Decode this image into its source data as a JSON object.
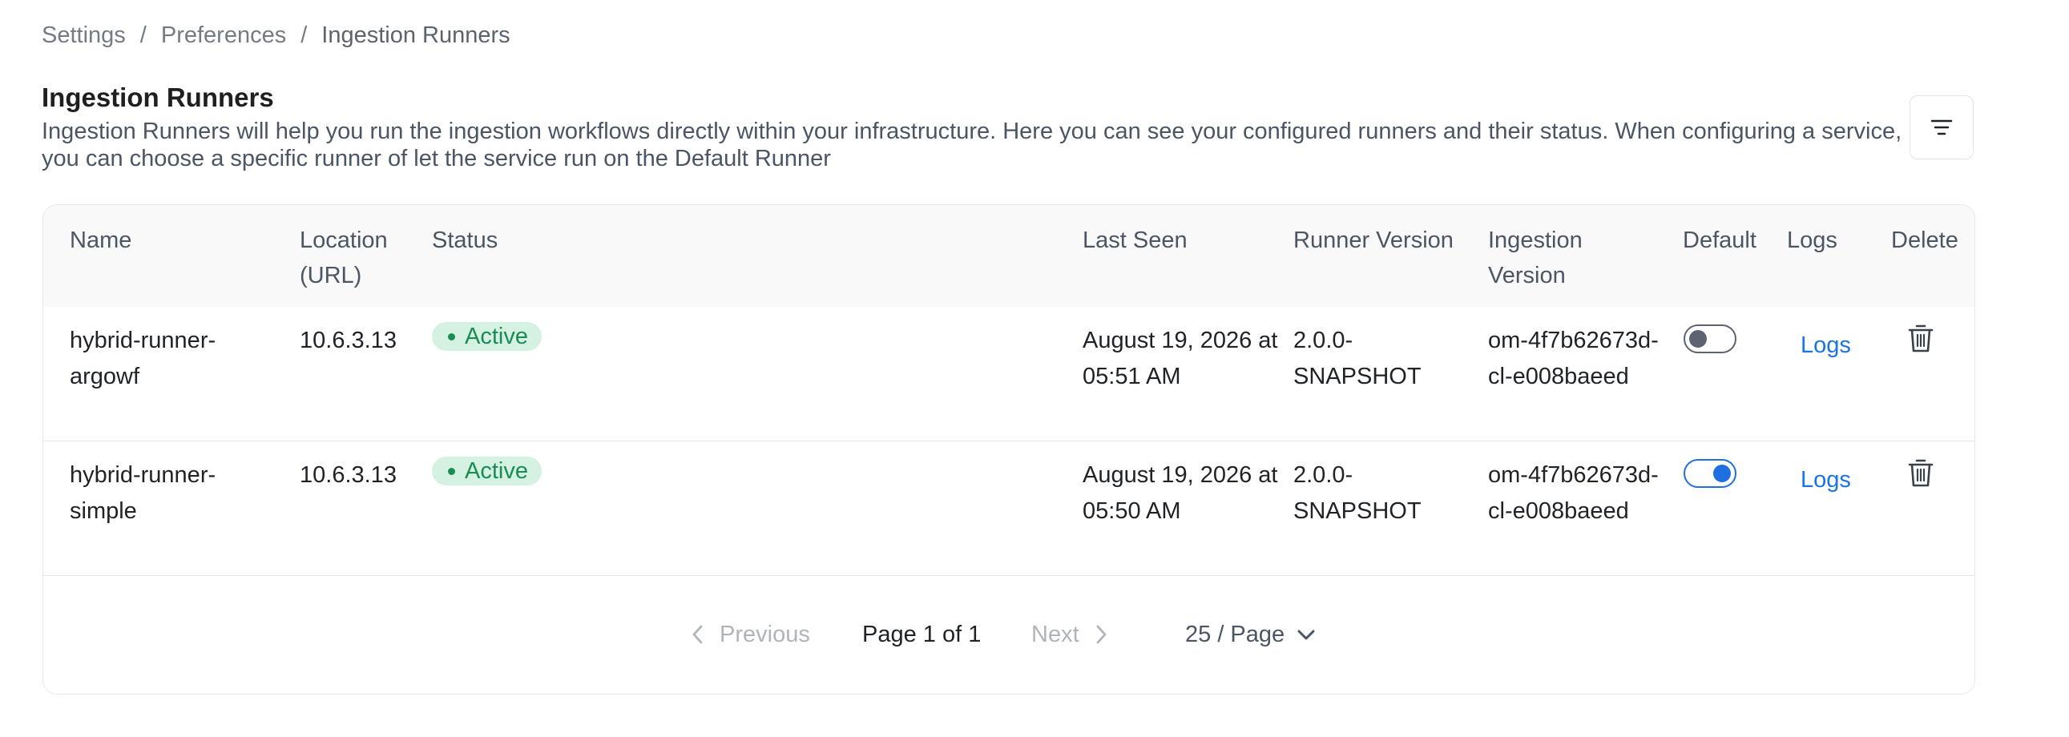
{
  "breadcrumb": {
    "items": [
      "Settings",
      "Preferences",
      "Ingestion Runners"
    ],
    "separator": "/"
  },
  "header": {
    "title": "Ingestion Runners",
    "description": "Ingestion Runners will help you run the ingestion workflows directly within your infrastructure. Here you can see your configured runners and their status. When configuring a service, you can choose a specific runner of let the service run on the Default Runner",
    "filter_icon": "filter-lines-icon"
  },
  "table": {
    "columns": {
      "name": "Name",
      "location": "Location (URL)",
      "status": "Status",
      "last_seen": "Last Seen",
      "runner_version": "Runner Version",
      "ingestion_version": "Ingestion Version",
      "default": "Default",
      "logs": "Logs",
      "delete": "Delete"
    },
    "rows": [
      {
        "name": "hybrid-runner-argowf",
        "location": "10.6.3.13",
        "status": "Active",
        "last_seen": "August 19, 2026 at 05:51 AM",
        "runner_version": "2.0.0-SNAPSHOT",
        "ingestion_version": "om-4f7b62673d-cl-e008baeed",
        "default": false,
        "logs": "Logs",
        "delete_icon": "trash-icon"
      },
      {
        "name": "hybrid-runner-simple",
        "location": "10.6.3.13",
        "status": "Active",
        "last_seen": "August 19, 2026 at 05:50 AM",
        "runner_version": "2.0.0-SNAPSHOT",
        "ingestion_version": "om-4f7b62673d-cl-e008baeed",
        "default": true,
        "logs": "Logs",
        "delete_icon": "trash-icon"
      }
    ]
  },
  "pagination": {
    "previous": "Previous",
    "page_info": "Page 1 of 1",
    "next": "Next",
    "page_size": "25 / Page"
  },
  "colors": {
    "status_active_bg": "#d5f1e2",
    "status_active_text": "#1a8c54",
    "link": "#1a73e8",
    "toggle_on": "#1f6fe0"
  }
}
